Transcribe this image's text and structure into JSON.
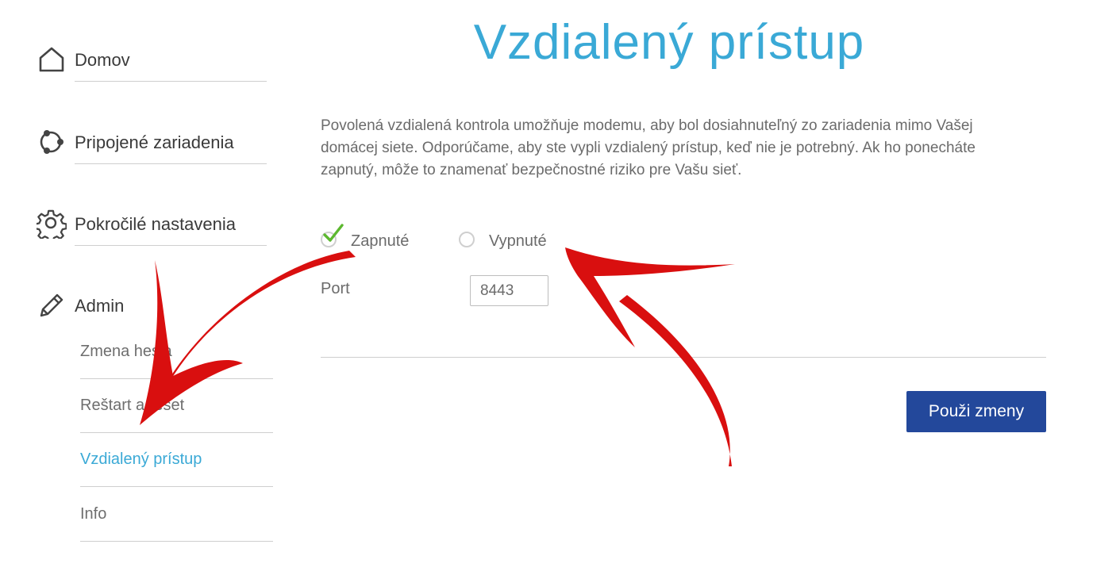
{
  "sidebar": {
    "items": [
      {
        "label": "Domov",
        "icon": "home-icon"
      },
      {
        "label": "Pripojené zariadenia",
        "icon": "connected-devices-icon"
      },
      {
        "label": "Pokročilé nastavenia",
        "icon": "gear-icon"
      },
      {
        "label": "Admin",
        "icon": "pencil-icon"
      }
    ],
    "admin_subitems": [
      {
        "label": "Zmena hesla"
      },
      {
        "label": "Reštart a reset"
      },
      {
        "label": "Vzdialený prístup",
        "active": true
      },
      {
        "label": "Info"
      }
    ]
  },
  "main": {
    "title": "Vzdialený prístup",
    "description": "Povolená vzdialená kontrola umožňuje modemu, aby bol dosiahnuteľný zo zariadenia mimo Vašej domácej siete. Odporúčame, aby ste vypli vzdialený prístup, keď nie je potrebný. Ak ho ponecháte zapnutý, môže to znamenať bezpečnostné riziko pre Vašu sieť.",
    "radio_on_label": "Zapnuté",
    "radio_off_label": "Vypnuté",
    "selected": "Zapnuté",
    "port_label": "Port",
    "port_value": "8443",
    "apply_label": "Použi zmeny"
  },
  "colors": {
    "accent": "#3aa9d6",
    "button": "#23489b",
    "check": "#5cb82f",
    "annotation_arrow": "#d90f0f"
  }
}
